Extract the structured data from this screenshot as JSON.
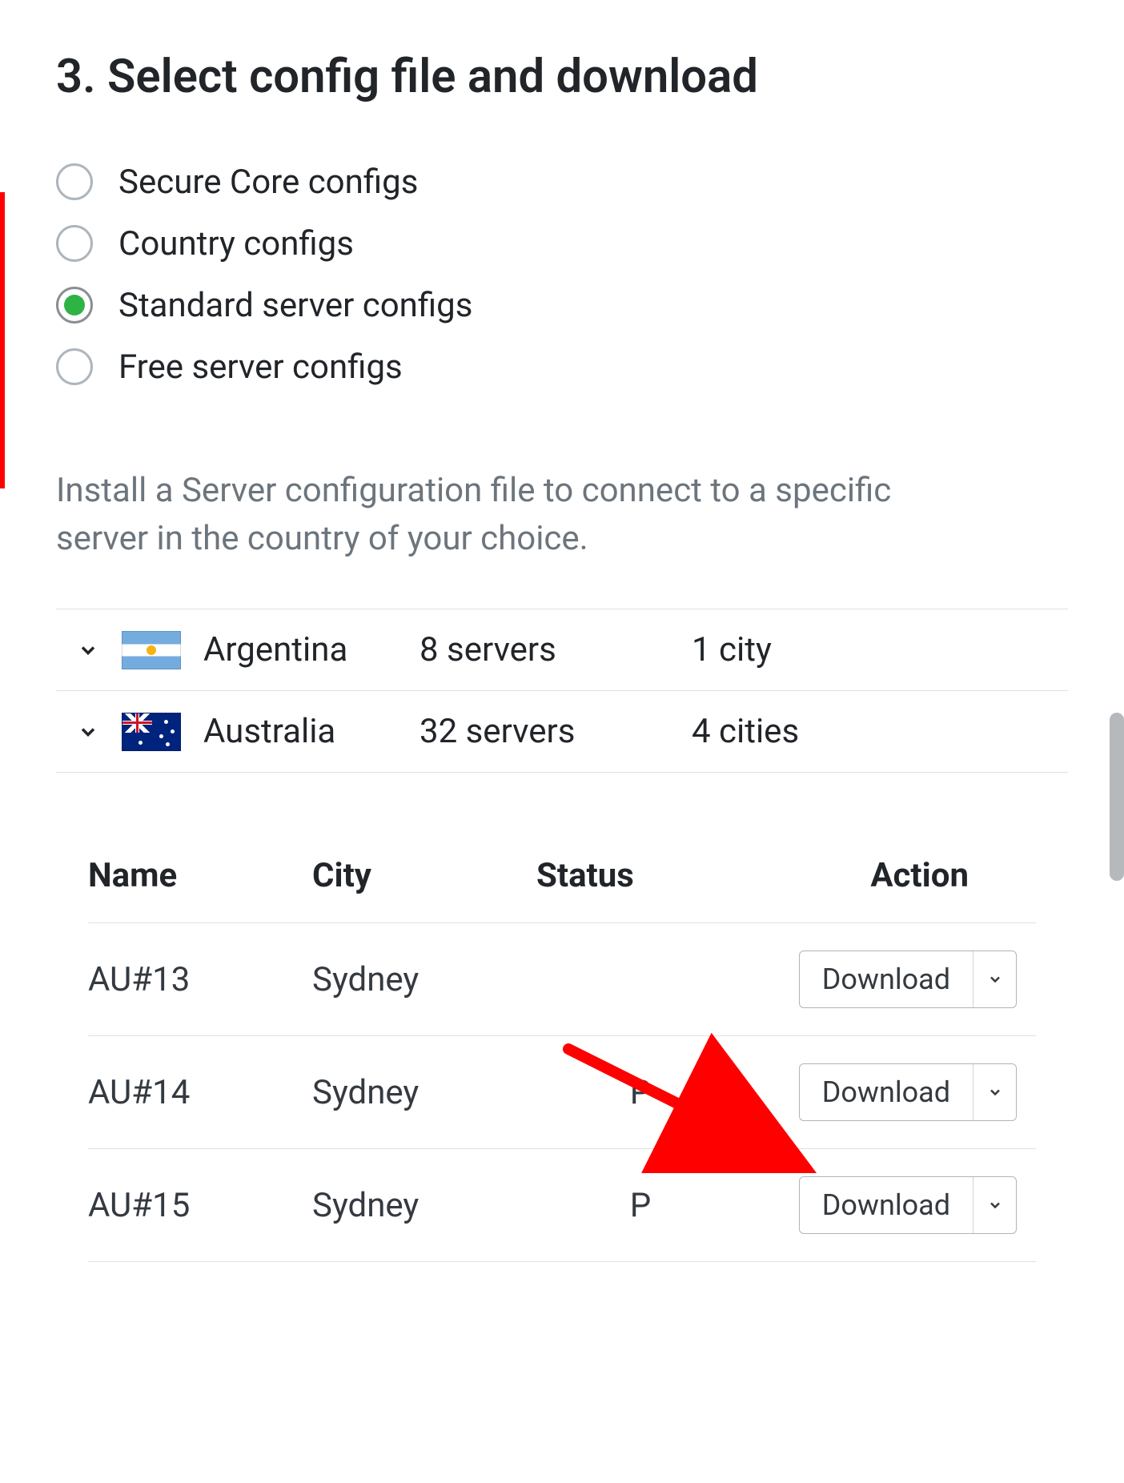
{
  "section_title": "3. Select config file and download",
  "config_options": [
    {
      "id": "secure-core",
      "label": "Secure Core configs",
      "selected": false
    },
    {
      "id": "country",
      "label": "Country configs",
      "selected": false
    },
    {
      "id": "standard-server",
      "label": "Standard server configs",
      "selected": true
    },
    {
      "id": "free-server",
      "label": "Free server configs",
      "selected": false
    }
  ],
  "description": "Install a Server configuration file to connect to a specific server in the country of your choice.",
  "countries": [
    {
      "name": "Argentina",
      "flag": "ar",
      "servers_label": "8 servers",
      "cities_label": "1 city",
      "expanded": false
    },
    {
      "name": "Australia",
      "flag": "au",
      "servers_label": "32 servers",
      "cities_label": "4 cities",
      "expanded": true
    }
  ],
  "table": {
    "headers": {
      "name": "Name",
      "city": "City",
      "status": "Status",
      "action": "Action"
    },
    "download_label": "Download",
    "rows": [
      {
        "name": "AU#13",
        "city": "Sydney",
        "status": ""
      },
      {
        "name": "AU#14",
        "city": "Sydney",
        "status": "P"
      },
      {
        "name": "AU#15",
        "city": "Sydney",
        "status": "P"
      }
    ]
  },
  "annotation": {
    "arrow_color": "#ff0000"
  }
}
